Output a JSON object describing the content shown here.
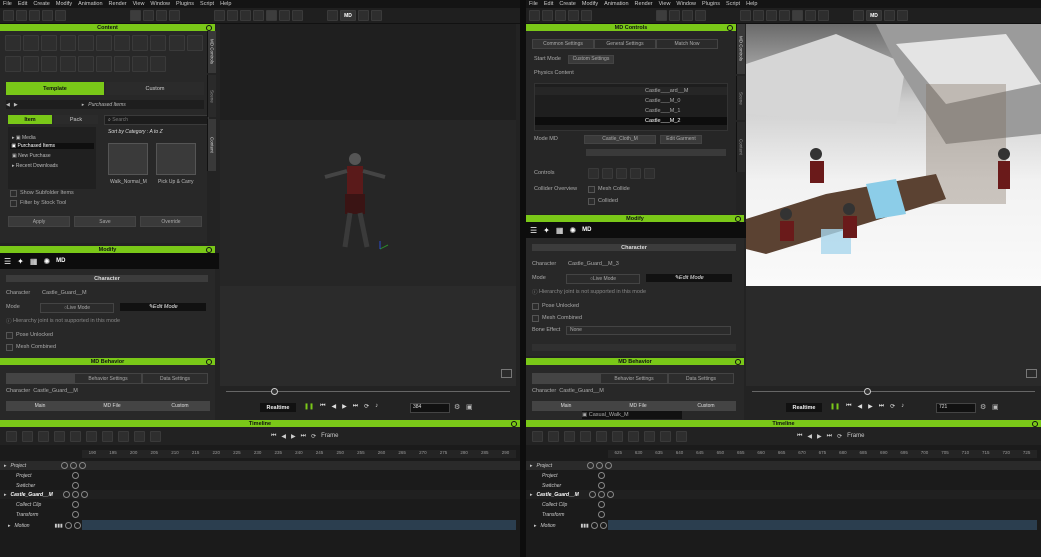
{
  "menus": [
    "File",
    "Edit",
    "Create",
    "Modify",
    "Animation",
    "Render",
    "View",
    "Window",
    "Plugins",
    "Script",
    "Help"
  ],
  "left": {
    "content_title": "Content",
    "tabs": {
      "template": "Template",
      "custom": "Custom"
    },
    "path": "Purchased Items",
    "search_placeholder": "Search",
    "sub_tabs": {
      "item": "Item",
      "pack": "Pack"
    },
    "sort_label": "Sort by Category : A to Z",
    "tree": [
      "Media",
      "Purchased Items",
      "New Purchase",
      "Recent Downloads"
    ],
    "thumbs": [
      "Walk_Normal_M",
      "Pick Up & Carry"
    ],
    "options": [
      "Show Subfolder Items",
      "Filter by Stock Tool"
    ],
    "content_btns": [
      "Apply",
      "Save",
      "Override"
    ],
    "modify_title": "Modify",
    "character_label": "Character",
    "character_field": "Character",
    "character_value": "Castle_Guard__M",
    "mode_label": "Mode",
    "live_mode": "Live Mode",
    "edit_mode": "Edit Mode",
    "warning": "Hierarchy joint is not supported in this mode",
    "pose_unlocked": "Pose Unlocked",
    "mesh_combined": "Mesh Combined",
    "behavior_title": "MD Behavior",
    "behavior_tabs": [
      "Behavior Settings",
      "Data Settings"
    ],
    "behavior_char": "Castle_Guard__M",
    "behavior_cols": [
      "Main",
      "MD File",
      "Custom"
    ],
    "vtabs": [
      "MD Controls",
      "Scene",
      "Content"
    ],
    "realtime": "Realtime",
    "frame": "384",
    "timeline_title": "Timeline",
    "frame_label": "Frame",
    "ruler": [
      "190",
      "195",
      "200",
      "205",
      "210",
      "215",
      "220",
      "225",
      "230",
      "235",
      "240",
      "245",
      "250",
      "255",
      "260",
      "265",
      "270",
      "275",
      "280",
      "285",
      "290"
    ],
    "tracks": [
      "Project",
      "Project",
      "Switcher",
      "Castle_Guard__M",
      "Collect Clip",
      "Transform",
      "Motion"
    ]
  },
  "right": {
    "md_controls_title": "MD Controls",
    "md_tabs": [
      "Common Settings",
      "General Settings",
      "Match Now"
    ],
    "start_mode_label": "Start Mode",
    "start_mode_value": "Custom Settings",
    "physics_label": "Physics Content",
    "list_items": [
      "Castle___ard__M",
      "Castle___M_0",
      "Castle___M_1",
      "Castle___M_2"
    ],
    "md_file_label": "Mode MD",
    "md_file_value": "Castle_Cloth_M",
    "edit_garment": "Edit Garment",
    "controls_label": "Controls",
    "collide_label": "Collider Overview",
    "collide_opts": [
      "Mesh Collide",
      "Collided"
    ],
    "modify_title": "Modify",
    "character_label": "Character",
    "character_field": "Character",
    "character_value": "Castle_Guard__M_3",
    "mode_label": "Mode",
    "live_mode": "Live Mode",
    "edit_mode": "Edit Mode",
    "warning": "Hierarchy joint is not supported in this mode",
    "pose_unlocked": "Pose Unlocked",
    "mesh_combined": "Mesh Combined",
    "bone_label": "Bone Effect",
    "bone_value": "None",
    "behavior_title": "MD Behavior",
    "behavior_tabs": [
      "Behavior Settings",
      "Data Settings"
    ],
    "behavior_char": "Castle_Guard__M",
    "behavior_cols": [
      "Main",
      "MD File",
      "Custom"
    ],
    "behavior_row": "Casual_Walk_M",
    "vtabs": [
      "MD Controls",
      "Scene",
      "Content"
    ],
    "realtime": "Realtime",
    "frame": "721",
    "timeline_title": "Timeline",
    "frame_label": "Frame",
    "ruler": [
      "625",
      "630",
      "635",
      "640",
      "645",
      "650",
      "655",
      "660",
      "665",
      "670",
      "675",
      "680",
      "685",
      "690",
      "695",
      "700",
      "705",
      "710",
      "715",
      "720",
      "725"
    ],
    "tracks": [
      "Project",
      "Project",
      "Switcher",
      "Castle_Guard__M",
      "Collect Clip",
      "Transform",
      "Motion"
    ]
  },
  "colors": {
    "accent": "#7ac818",
    "background": "#232323"
  }
}
